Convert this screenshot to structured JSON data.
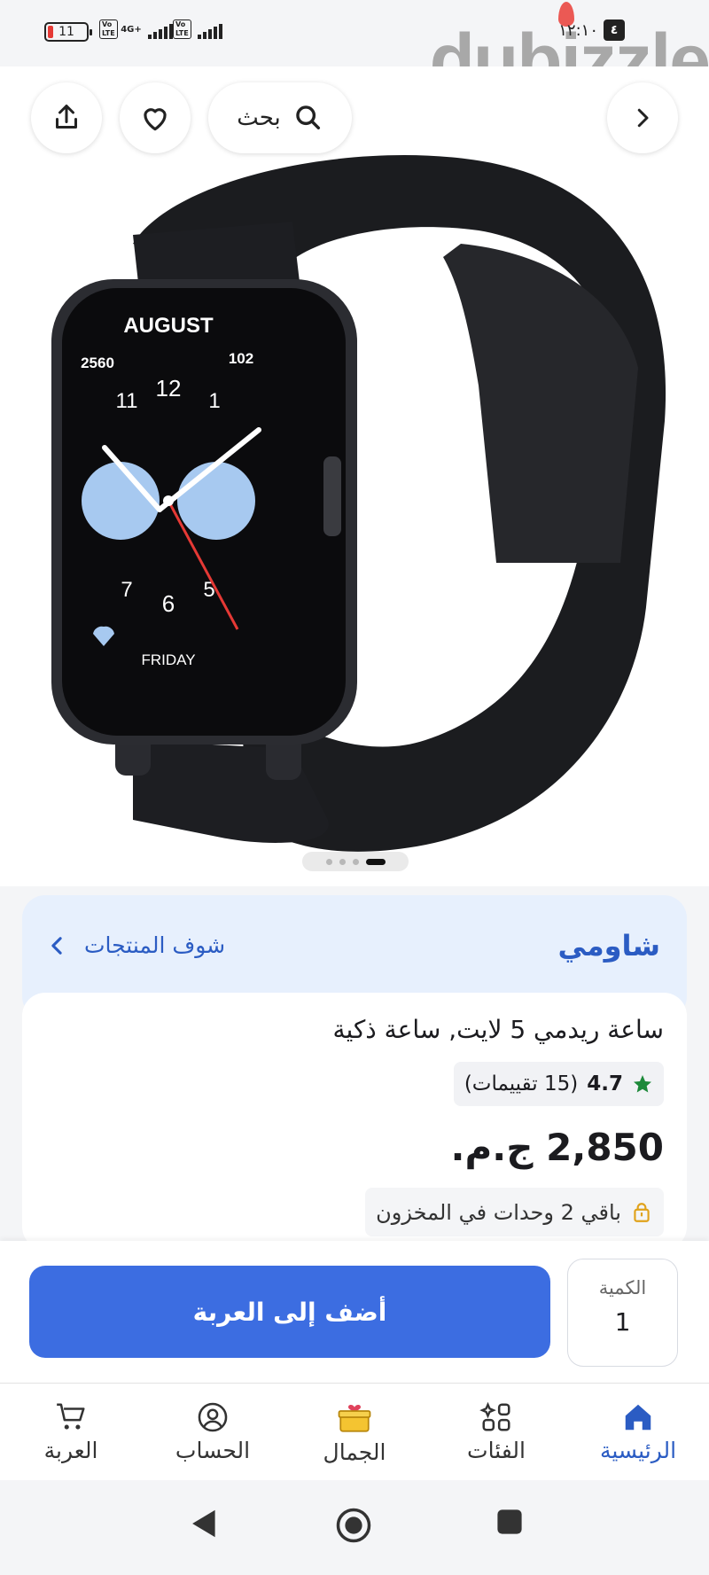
{
  "status_bar": {
    "battery": "11",
    "network_1": "4G+",
    "volte": "Vo LTE",
    "clock": "١٢:١٠",
    "sim_indicator": "٤",
    "watermark": "dubizzle"
  },
  "header": {
    "search_label": "بحث",
    "icons": [
      "share-icon",
      "heart-icon",
      "search-icon",
      "chevron-right-icon"
    ]
  },
  "image_pager": {
    "count": 4,
    "active_index": 3
  },
  "brand": {
    "name": "شاومي",
    "see_products": "شوف المنتجات"
  },
  "product": {
    "title": "ساعة ريدمي 5 لايت, ساعة ذكية",
    "rating_value": "4.7",
    "rating_count": "(15 تقييمات)",
    "price": "2,850 ج.م.",
    "stock": "باقي 2 وحدات في المخزون"
  },
  "cart": {
    "add_to_cart": "أضف إلى العربة",
    "quantity_label": "الكمية",
    "quantity_value": "1"
  },
  "bottom_nav": {
    "items": [
      {
        "label": "الرئيسية",
        "icon": "home-icon",
        "active": true
      },
      {
        "label": "الفئات",
        "icon": "categories-icon",
        "active": false
      },
      {
        "label": "الجمال",
        "icon": "gift-box-icon",
        "active": false
      },
      {
        "label": "الحساب",
        "icon": "account-icon",
        "active": false
      },
      {
        "label": "العربة",
        "icon": "cart-icon",
        "active": false
      }
    ]
  },
  "colors": {
    "primary": "#3c6de1",
    "brand_text": "#2b5cc3",
    "brand_card_bg": "#e7f0fd",
    "star": "#1d8a3a",
    "lock_icon": "#e0a21b"
  }
}
